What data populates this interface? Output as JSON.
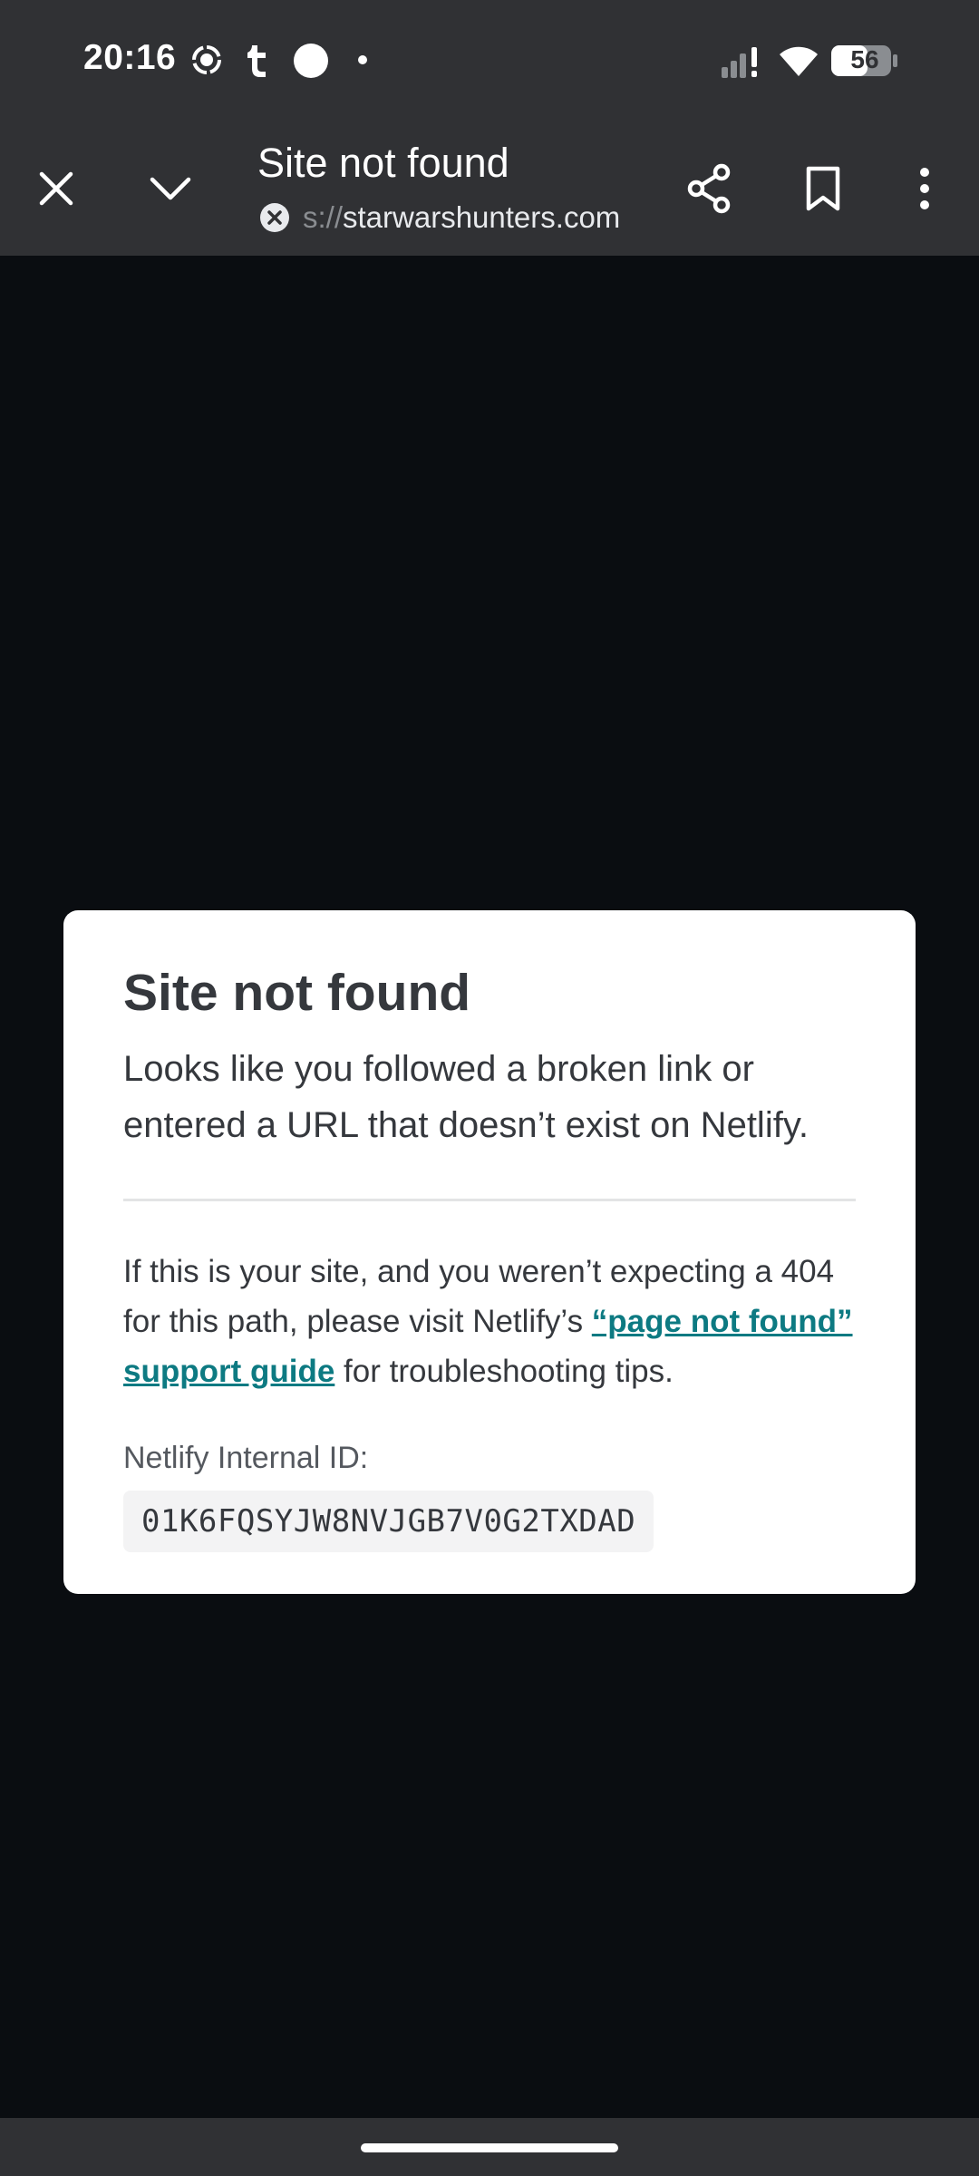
{
  "status_bar": {
    "time": "20:16",
    "battery_level": "56",
    "icons": [
      "focus-mode-icon",
      "tumblr-icon",
      "circle-notification-icon",
      "dot-icon",
      "signal-icon",
      "wifi-icon",
      "battery-icon"
    ]
  },
  "toolbar": {
    "title": "Site not found",
    "url_scheme": "s://",
    "url_host": "starwarshunters.com",
    "icons": [
      "close-icon",
      "chevron-down-icon",
      "not-secure-icon",
      "share-icon",
      "bookmark-icon",
      "more-vert-icon"
    ]
  },
  "page": {
    "title": "Site not found",
    "lead": "Looks like you followed a broken link or entered a URL that doesn’t exist on Netlify.",
    "body_before_link": "If this is your site, and you weren’t expecting a 404 for this path, please visit Netlify’s ",
    "link_text": "“page not found” support guide",
    "body_after_link": " for troubleshooting tips.",
    "id_label": "Netlify Internal ID:",
    "id_value": "01K6FQSYJW8NVJGB7V0G2TXDAD"
  },
  "colors": {
    "chrome_bg": "#303134",
    "page_bg": "#0a0d11",
    "card_bg": "#ffffff",
    "text": "#35383d",
    "link": "#0d7a82"
  }
}
